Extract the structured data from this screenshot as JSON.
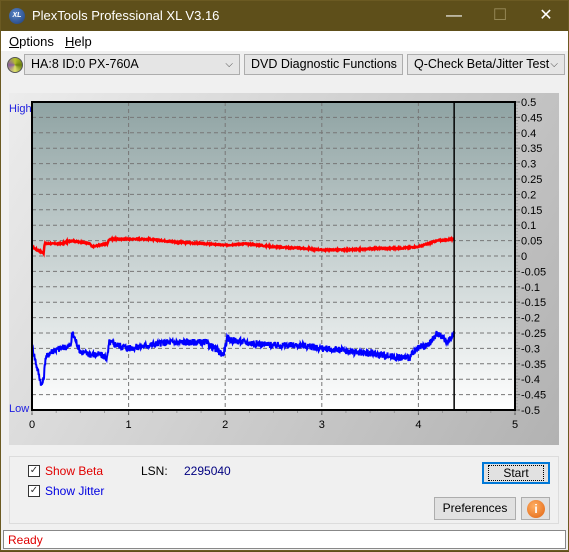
{
  "window": {
    "title": "PlexTools Professional XL V3.16",
    "app_icon": "XL",
    "minimize_icon": "—",
    "maximize_icon": "☐",
    "close_icon": "✕"
  },
  "menu": {
    "items": [
      {
        "label": "Options",
        "accel": "O"
      },
      {
        "label": "Help",
        "accel": "H"
      }
    ]
  },
  "toolbar": {
    "drive": "HA:8 ID:0  PX-760A",
    "function_group": "DVD Diagnostic Functions",
    "test": "Q-Check Beta/Jitter Test",
    "chevron": "⌵"
  },
  "controls": {
    "show_beta": {
      "label": "Show Beta",
      "checked": true,
      "color": "#e00000"
    },
    "show_jitter": {
      "label": "Show Jitter",
      "checked": true,
      "color": "#0000e0"
    },
    "lsn_label": "LSN:",
    "lsn_value": "2295040",
    "start_label": "Start",
    "preferences_label": "Preferences",
    "info_icon": "i"
  },
  "status": {
    "text": "Ready"
  },
  "chart_data": {
    "type": "line",
    "title": "",
    "xlabel": "",
    "ylabel": "",
    "left_axis_labels": {
      "top": "High",
      "bottom": "Low"
    },
    "xlim": [
      0,
      5
    ],
    "ylim": [
      -0.5,
      0.5
    ],
    "x_ticks": [
      "0",
      "1",
      "2",
      "3",
      "4",
      "5"
    ],
    "y_ticks": [
      "0.5",
      "0.45",
      "0.4",
      "0.35",
      "0.3",
      "0.25",
      "0.2",
      "0.15",
      "0.1",
      "0.05",
      "0",
      "-0.05",
      "-0.1",
      "-0.15",
      "-0.2",
      "-0.25",
      "-0.3",
      "-0.35",
      "-0.4",
      "-0.45",
      "-0.5"
    ],
    "grid": true,
    "marker_x": 4.37,
    "series": [
      {
        "name": "Beta",
        "color": "#ff0000",
        "x": [
          0,
          0.05,
          0.12,
          0.13,
          0.3,
          0.4,
          0.6,
          0.62,
          0.78,
          0.8,
          1.0,
          1.2,
          1.5,
          1.8,
          2.0,
          2.2,
          2.5,
          2.8,
          3.0,
          3.3,
          3.6,
          3.8,
          4.0,
          4.2,
          4.37
        ],
        "y": [
          0.03,
          0.02,
          0.01,
          0.04,
          0.04,
          0.05,
          0.04,
          0.03,
          0.04,
          0.055,
          0.055,
          0.055,
          0.045,
          0.04,
          0.035,
          0.04,
          0.03,
          0.025,
          0.02,
          0.02,
          0.025,
          0.025,
          0.03,
          0.05,
          0.055
        ]
      },
      {
        "name": "Jitter",
        "color": "#0000ff",
        "x": [
          0,
          0.05,
          0.1,
          0.12,
          0.14,
          0.2,
          0.3,
          0.4,
          0.42,
          0.5,
          0.6,
          0.7,
          0.78,
          0.8,
          1.0,
          1.2,
          1.4,
          1.6,
          1.8,
          1.98,
          2.02,
          2.2,
          2.5,
          2.8,
          3.0,
          3.3,
          3.6,
          3.8,
          3.9,
          4.0,
          4.1,
          4.2,
          4.3,
          4.37
        ],
        "y": [
          -0.29,
          -0.36,
          -0.42,
          -0.4,
          -0.33,
          -0.31,
          -0.3,
          -0.29,
          -0.25,
          -0.31,
          -0.32,
          -0.32,
          -0.33,
          -0.28,
          -0.3,
          -0.29,
          -0.28,
          -0.28,
          -0.28,
          -0.32,
          -0.27,
          -0.28,
          -0.29,
          -0.29,
          -0.3,
          -0.31,
          -0.32,
          -0.33,
          -0.33,
          -0.3,
          -0.29,
          -0.25,
          -0.28,
          -0.25
        ]
      }
    ]
  }
}
